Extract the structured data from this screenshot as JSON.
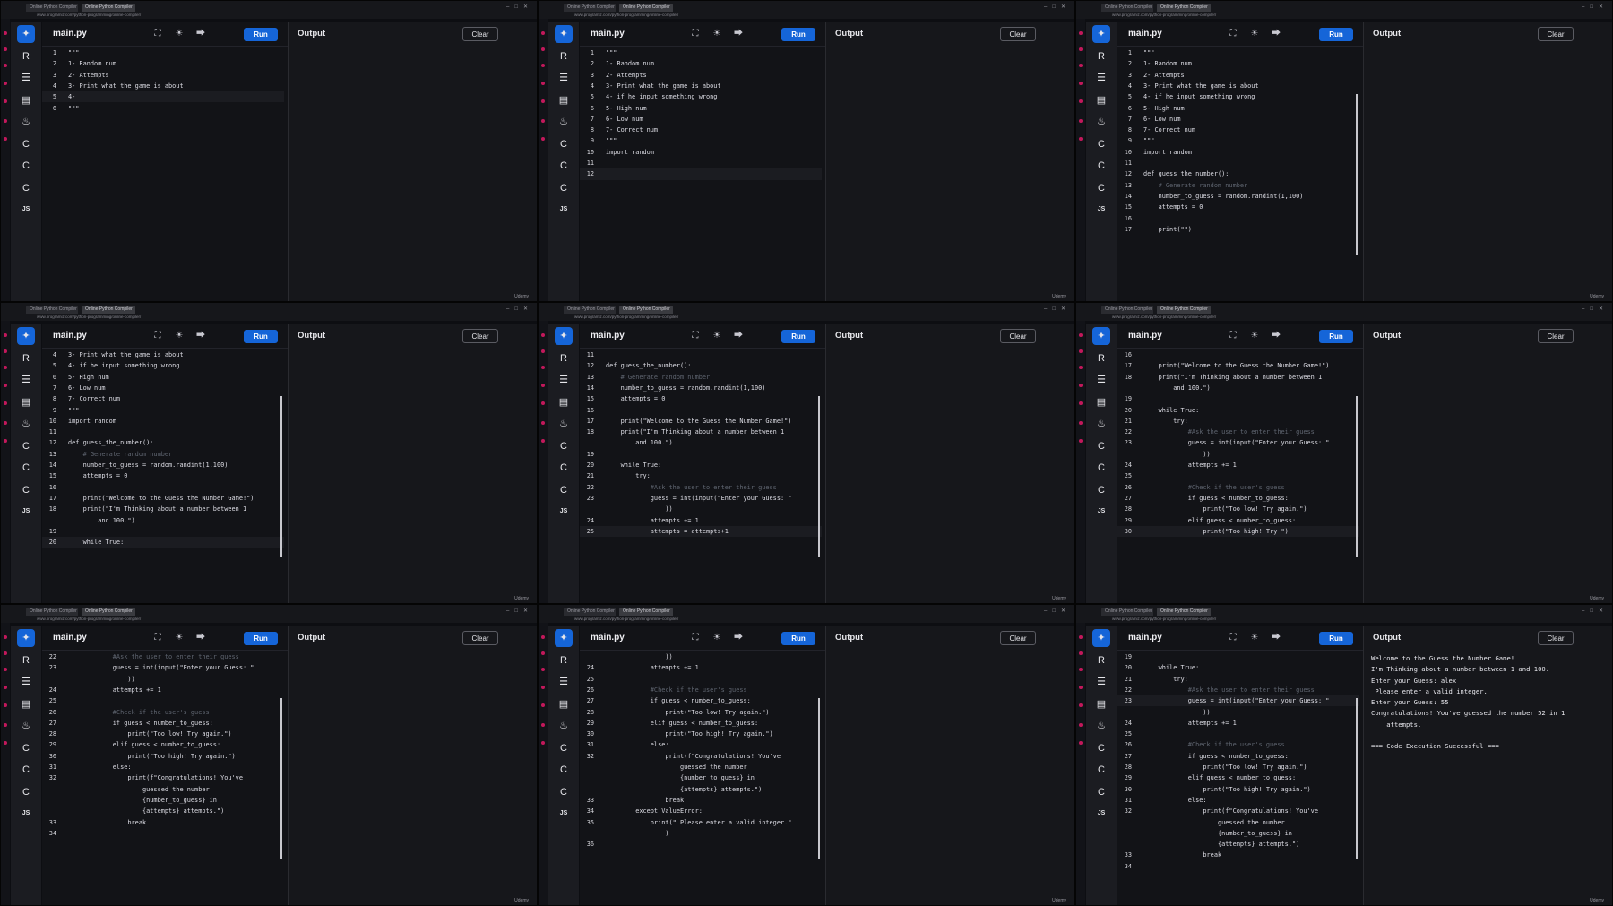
{
  "common": {
    "tab1": "Online Python Compiler",
    "tab2": "Online Python Compiler",
    "address": "www.programiz.com/python-programming/online-compiler/",
    "file_name": "main.py",
    "run_label": "Run",
    "output_label": "Output",
    "clear_label": "Clear",
    "watermark": "Udemy",
    "sidebar_js": "JS"
  },
  "colors": {
    "accent": "#1565d8",
    "comment": "#5f6570",
    "number": "#e06c75",
    "background": "#0d0e12"
  },
  "panels": [
    {
      "lines": [
        {
          "n": "1",
          "t": "\"\"\""
        },
        {
          "n": "2",
          "t": "1- Random num"
        },
        {
          "n": "3",
          "t": "2- Attempts"
        },
        {
          "n": "4",
          "t": "3- Print what the game is about"
        },
        {
          "n": "5",
          "t": "4-",
          "hl": true
        },
        {
          "n": "6",
          "t": "\"\"\""
        }
      ],
      "output": []
    },
    {
      "lines": [
        {
          "n": "1",
          "t": "\"\"\""
        },
        {
          "n": "2",
          "t": "1- Random num"
        },
        {
          "n": "3",
          "t": "2- Attempts"
        },
        {
          "n": "4",
          "t": "3- Print what the game is about"
        },
        {
          "n": "5",
          "t": "4- if he input something wrong"
        },
        {
          "n": "6",
          "t": "5- High num"
        },
        {
          "n": "7",
          "t": "6- Low num"
        },
        {
          "n": "8",
          "t": "7- Correct num"
        },
        {
          "n": "9",
          "t": "\"\"\""
        },
        {
          "n": "10",
          "t": "import random"
        },
        {
          "n": "11",
          "t": ""
        },
        {
          "n": "12",
          "t": "",
          "hl": true
        }
      ],
      "output": []
    },
    {
      "lines": [
        {
          "n": "1",
          "t": "\"\"\""
        },
        {
          "n": "2",
          "t": "1- Random num"
        },
        {
          "n": "3",
          "t": "2- Attempts"
        },
        {
          "n": "4",
          "t": "3- Print what the game is about"
        },
        {
          "n": "5",
          "t": "4- if he input something wrong"
        },
        {
          "n": "6",
          "t": "5- High num"
        },
        {
          "n": "7",
          "t": "6- Low num"
        },
        {
          "n": "8",
          "t": "7- Correct num"
        },
        {
          "n": "9",
          "t": "\"\"\""
        },
        {
          "n": "10",
          "t": "import random"
        },
        {
          "n": "11",
          "t": ""
        },
        {
          "n": "12",
          "t": "def guess_the_number():"
        },
        {
          "n": "13",
          "t": "    # Generate random number",
          "c": true
        },
        {
          "n": "14",
          "t": "    number_to_guess = random.randint(1,100)"
        },
        {
          "n": "15",
          "t": "    attempts = 0"
        },
        {
          "n": "16",
          "t": ""
        },
        {
          "n": "17",
          "t": "    print(\"\")"
        }
      ],
      "output": []
    },
    {
      "lines": [
        {
          "n": "4",
          "t": "3- Print what the game is about"
        },
        {
          "n": "5",
          "t": "4- if he input something wrong"
        },
        {
          "n": "6",
          "t": "5- High num"
        },
        {
          "n": "7",
          "t": "6- Low num"
        },
        {
          "n": "8",
          "t": "7- Correct num"
        },
        {
          "n": "9",
          "t": "\"\"\""
        },
        {
          "n": "10",
          "t": "import random"
        },
        {
          "n": "11",
          "t": ""
        },
        {
          "n": "12",
          "t": "def guess_the_number():"
        },
        {
          "n": "13",
          "t": "    # Generate random number",
          "c": true
        },
        {
          "n": "14",
          "t": "    number_to_guess = random.randint(1,100)"
        },
        {
          "n": "15",
          "t": "    attempts = 0"
        },
        {
          "n": "16",
          "t": ""
        },
        {
          "n": "17",
          "t": "    print(\"Welcome to the Guess the Number Game!\")"
        },
        {
          "n": "18",
          "t": "    print(\"I'm Thinking about a number between 1"
        },
        {
          "n": "",
          "t": "        and 100.\")"
        },
        {
          "n": "19",
          "t": ""
        },
        {
          "n": "20",
          "t": "    while True:",
          "hl": true
        }
      ],
      "output": []
    },
    {
      "lines": [
        {
          "n": "11",
          "t": ""
        },
        {
          "n": "12",
          "t": "def guess_the_number():"
        },
        {
          "n": "13",
          "t": "    # Generate random number",
          "c": true
        },
        {
          "n": "14",
          "t": "    number_to_guess = random.randint(1,100)"
        },
        {
          "n": "15",
          "t": "    attempts = 0"
        },
        {
          "n": "16",
          "t": ""
        },
        {
          "n": "17",
          "t": "    print(\"Welcome to the Guess the Number Game!\")"
        },
        {
          "n": "18",
          "t": "    print(\"I'm Thinking about a number between 1"
        },
        {
          "n": "",
          "t": "        and 100.\")"
        },
        {
          "n": "19",
          "t": ""
        },
        {
          "n": "20",
          "t": "    while True:"
        },
        {
          "n": "21",
          "t": "        try:"
        },
        {
          "n": "22",
          "t": "            #Ask the user to enter their guess",
          "c": true
        },
        {
          "n": "23",
          "t": "            guess = int(input(\"Enter your Guess: \""
        },
        {
          "n": "",
          "t": "                ))"
        },
        {
          "n": "24",
          "t": "            attempts += 1"
        },
        {
          "n": "25",
          "t": "            attempts = attempts+1",
          "hl": true
        }
      ],
      "output": []
    },
    {
      "lines": [
        {
          "n": "16",
          "t": ""
        },
        {
          "n": "17",
          "t": "    print(\"Welcome to the Guess the Number Game!\")"
        },
        {
          "n": "18",
          "t": "    print(\"I'm Thinking about a number between 1"
        },
        {
          "n": "",
          "t": "        and 100.\")"
        },
        {
          "n": "19",
          "t": ""
        },
        {
          "n": "20",
          "t": "    while True:"
        },
        {
          "n": "21",
          "t": "        try:"
        },
        {
          "n": "22",
          "t": "            #Ask the user to enter their guess",
          "c": true
        },
        {
          "n": "23",
          "t": "            guess = int(input(\"Enter your Guess: \""
        },
        {
          "n": "",
          "t": "                ))"
        },
        {
          "n": "24",
          "t": "            attempts += 1"
        },
        {
          "n": "25",
          "t": ""
        },
        {
          "n": "26",
          "t": "            #Check if the user's guess",
          "c": true
        },
        {
          "n": "27",
          "t": "            if guess < number_to_guess:"
        },
        {
          "n": "28",
          "t": "                print(\"Too low! Try again.\")"
        },
        {
          "n": "29",
          "t": "            elif guess < number_to_guess:"
        },
        {
          "n": "30",
          "t": "                print(\"Too high! Try \")",
          "hl": true
        }
      ],
      "output": []
    },
    {
      "lines": [
        {
          "n": "22",
          "t": "            #Ask the user to enter their guess",
          "c": true
        },
        {
          "n": "23",
          "t": "            guess = int(input(\"Enter your Guess: \""
        },
        {
          "n": "",
          "t": "                ))"
        },
        {
          "n": "24",
          "t": "            attempts += 1"
        },
        {
          "n": "25",
          "t": ""
        },
        {
          "n": "26",
          "t": "            #Check if the user's guess",
          "c": true
        },
        {
          "n": "27",
          "t": "            if guess < number_to_guess:"
        },
        {
          "n": "28",
          "t": "                print(\"Too low! Try again.\")"
        },
        {
          "n": "29",
          "t": "            elif guess < number_to_guess:"
        },
        {
          "n": "30",
          "t": "                print(\"Too high! Try again.\")"
        },
        {
          "n": "31",
          "t": "            else:"
        },
        {
          "n": "32",
          "t": "                print(f\"Congratulations! You've"
        },
        {
          "n": "",
          "t": "                    guessed the number"
        },
        {
          "n": "",
          "t": "                    {number_to_guess} in"
        },
        {
          "n": "",
          "t": "                    {attempts} attempts.\")"
        },
        {
          "n": "33",
          "t": "                break"
        },
        {
          "n": "34",
          "t": ""
        }
      ],
      "output": []
    },
    {
      "lines": [
        {
          "n": "",
          "t": "                ))"
        },
        {
          "n": "24",
          "t": "            attempts += 1"
        },
        {
          "n": "25",
          "t": ""
        },
        {
          "n": "26",
          "t": "            #Check if the user's guess",
          "c": true
        },
        {
          "n": "27",
          "t": "            if guess < number_to_guess:"
        },
        {
          "n": "28",
          "t": "                print(\"Too low! Try again.\")"
        },
        {
          "n": "29",
          "t": "            elif guess < number_to_guess:"
        },
        {
          "n": "30",
          "t": "                print(\"Too high! Try again.\")"
        },
        {
          "n": "31",
          "t": "            else:"
        },
        {
          "n": "32",
          "t": "                print(f\"Congratulations! You've"
        },
        {
          "n": "",
          "t": "                    guessed the number"
        },
        {
          "n": "",
          "t": "                    {number_to_guess} in"
        },
        {
          "n": "",
          "t": "                    {attempts} attempts.\")"
        },
        {
          "n": "33",
          "t": "                break"
        },
        {
          "n": "34",
          "t": "        except ValueError:"
        },
        {
          "n": "35",
          "t": "            print(\" Please enter a valid integer.\""
        },
        {
          "n": "",
          "t": "                )"
        },
        {
          "n": "36",
          "t": ""
        }
      ],
      "output": []
    },
    {
      "lines": [
        {
          "n": "19",
          "t": ""
        },
        {
          "n": "20",
          "t": "    while True:"
        },
        {
          "n": "21",
          "t": "        try:"
        },
        {
          "n": "22",
          "t": "            #Ask the user to enter their guess",
          "c": true
        },
        {
          "n": "23",
          "t": "            guess = int(input(\"Enter your Guess: \"",
          "hl": true
        },
        {
          "n": "",
          "t": "                ))"
        },
        {
          "n": "24",
          "t": "            attempts += 1"
        },
        {
          "n": "25",
          "t": ""
        },
        {
          "n": "26",
          "t": "            #Check if the user's guess",
          "c": true
        },
        {
          "n": "27",
          "t": "            if guess < number_to_guess:"
        },
        {
          "n": "28",
          "t": "                print(\"Too low! Try again.\")"
        },
        {
          "n": "29",
          "t": "            elif guess < number_to_guess:"
        },
        {
          "n": "30",
          "t": "                print(\"Too high! Try again.\")"
        },
        {
          "n": "31",
          "t": "            else:"
        },
        {
          "n": "32",
          "t": "                print(f\"Congratulations! You've"
        },
        {
          "n": "",
          "t": "                    guessed the number"
        },
        {
          "n": "",
          "t": "                    {number_to_guess} in"
        },
        {
          "n": "",
          "t": "                    {attempts} attempts.\")"
        },
        {
          "n": "33",
          "t": "                break"
        },
        {
          "n": "34",
          "t": ""
        }
      ],
      "output": [
        "Welcome to the Guess the Number Game!",
        "I'm Thinking about a number between 1 and 100.",
        "Enter your Guess: alex",
        " Please enter a valid integer.",
        "Enter your Guess: 55",
        "Congratulations! You've guessed the number 52 in 1",
        "    attempts.",
        "",
        "=== Code Execution Successful ==="
      ]
    }
  ]
}
